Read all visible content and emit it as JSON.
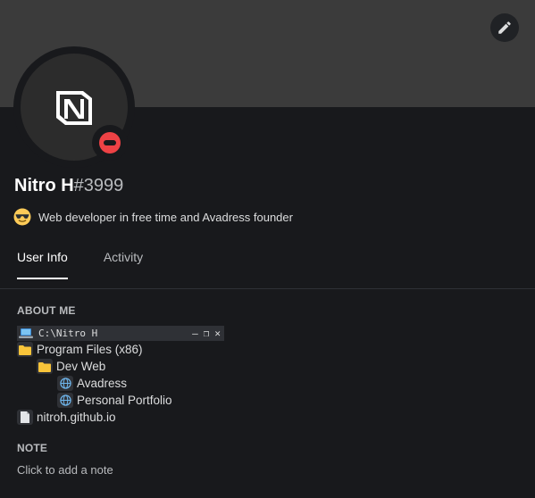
{
  "profile": {
    "username": "Nitro H",
    "discriminator": "#3999",
    "status": "dnd",
    "custom_status": {
      "emoji": "sunglasses-emoji",
      "text": "Web developer in free time and Avadress founder"
    },
    "avatar_icon": "notion-n-logo-icon"
  },
  "colors": {
    "banner": "#3b3b3b",
    "background": "#18191c",
    "dnd": "#ed4245",
    "folder": "#f8c43a"
  },
  "tabs": [
    {
      "label": "User Info",
      "active": true
    },
    {
      "label": "Activity",
      "active": false
    }
  ],
  "about_me": {
    "title": "ABOUT ME",
    "terminal": {
      "title": "C:\\Nitro H",
      "controls": [
        "–",
        "❐",
        "✕"
      ]
    },
    "tree": [
      {
        "label": "Program Files (x86)",
        "icon": "folder-icon"
      },
      {
        "label": "Dev Web",
        "icon": "folder-icon"
      },
      {
        "label": "Avadress",
        "icon": "globe-icon"
      },
      {
        "label": "Personal Portfolio",
        "icon": "globe-icon"
      },
      {
        "label": "nitroh.github.io",
        "icon": "page-icon"
      }
    ]
  },
  "note": {
    "title": "NOTE",
    "placeholder": "Click to add a note"
  }
}
